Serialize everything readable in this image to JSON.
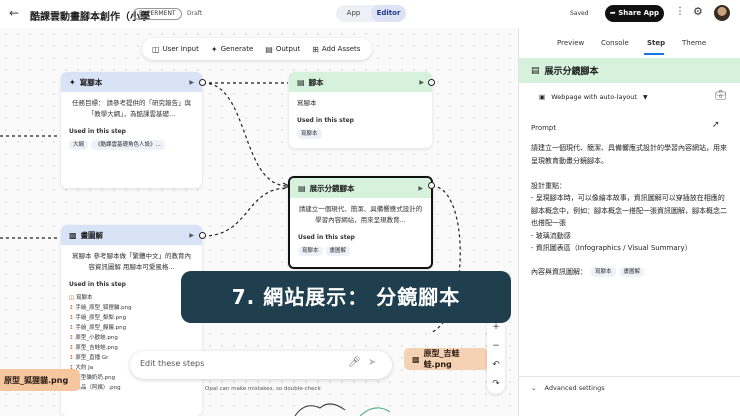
{
  "header": {
    "back_icon": "arrow-left-icon",
    "title": "酷課雲動畫腳本創作（小學",
    "badge": "EXPERMENT",
    "status": "Draft",
    "mode_app": "App",
    "mode_editor": "Editor",
    "saved": "Saved",
    "share": "Share App"
  },
  "toolbar": {
    "user_input": "User Input",
    "generate": "Generate",
    "output": "Output",
    "add_assets": "Add Assets"
  },
  "nodes": {
    "script_step": {
      "title": "寫腳本",
      "body": "任務目標： 請參考提供的「研究報告」與「教學大綱」，為酷課雲基礎...",
      "used_label": "Used in this step",
      "chips": [
        "大綱",
        "《酷課雲基礎角色人設》..."
      ]
    },
    "script_output": {
      "title": "腳本",
      "body": "寫腳本",
      "used_label": "Used in this step",
      "chips": [
        "寫腳本"
      ]
    },
    "storyboard": {
      "title": "展示分鏡腳本",
      "body": "請建立一個現代、簡潔、具備響應式設計的學習內容網站，用來呈現教育...",
      "used_label": "Used in this step",
      "chips": [
        "寫腳本",
        "畫圖解"
      ]
    },
    "illustrate": {
      "title": "畫圖解",
      "body": "寫腳本 參考腳本做「繁體中文」的教育內容資訊圖解 用腳本可愛風格...",
      "used_label": "Used in this step",
      "assets": [
        "寫腳本",
        "手繪_原型_狐狸貓.png",
        "手繪_原型_梨梨.png",
        "手繪_原型_饅饅.png",
        "原型_小歡蛙.png",
        "原型_吉蛙蛙.png",
        "原型_直播",
        "大約",
        "原型貓奶奶.png",
        "黑品（阿姨）.png"
      ],
      "asset_suffix": [
        "",
        "",
        "",
        "",
        "",
        "",
        "Gr",
        "Ja",
        "",
        ""
      ]
    },
    "float_left": "原型_狐狸貓.png",
    "float_right": "原型_吉蛙蛙.png"
  },
  "edit": {
    "placeholder": "Edit these steps",
    "disclaimer": "Opal can make mistakes, so double-check"
  },
  "caption": "7. 網站展示： 分鏡腳本",
  "panel": {
    "tabs": [
      "Preview",
      "Console",
      "Step",
      "Theme"
    ],
    "active_tab": "Step",
    "step_title": "展示分鏡腳本",
    "layout": "Webpage with auto-layout",
    "prompt_label": "Prompt",
    "prompt_text": "請建立一個現代、簡潔、具備響應式設計的學習內容網站，用來呈現教育動畫分鏡腳本。\n\n設計重點：\n- 呈現腳本時，可以像繪本故事，資訊圖解可以穿插放在相應的腳本概念中，例如：腳本概念一搭配一張資訊圖解，腳本概念二也搭配一張\n- 玻璃流動感\n- 資訊圖表區（Infographics / Visual Summary）",
    "content_label": "內容與資訊圖解：",
    "content_chips": [
      "寫腳本",
      "畫圖解"
    ],
    "advanced": "Advanced settings"
  },
  "colors": {
    "blue_head": "#d9e3f8",
    "green_head": "#d6f2dc",
    "caption_bg": "#1f3f4f",
    "float_left": "#f6c79f",
    "float_right": "#f6d2b4"
  }
}
